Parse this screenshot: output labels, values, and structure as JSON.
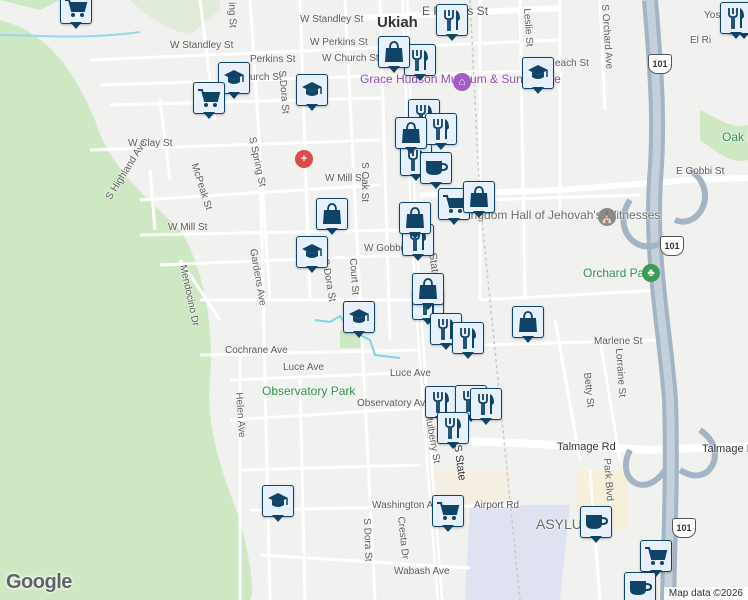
{
  "city": "Ukiah",
  "places": {
    "museum": "Grace Hudson Museum & Sun House",
    "kingdom_hall": "Kingdom Hall of Jehovah's Witnesses",
    "orchard_park": "Orchard Park",
    "observatory_park": "Observatory Park",
    "oak_manor_partial": "Oak M",
    "asylum_partial": "ASYLU"
  },
  "streets": {
    "w_standley": "W Standley St",
    "w_standley2": "W Standley St",
    "w_perkins": "W Perkins St",
    "w_perkins2": "Perkins St",
    "e_perkins": "E Perkins St",
    "w_church": "W Church St",
    "church2": "urch St",
    "w_clay": "W Clay St",
    "w_mill": "W Mill St",
    "w_mill2": "W Mill St",
    "w_gobbi": "W Gobbi St",
    "e_gobbi": "E Gobbi St",
    "s_oak": "S Oak St",
    "s_highland": "S Highland Ave",
    "mcpeak": "McPeak St",
    "s_spring": "S Spring St",
    "s_dora": "S Dora St",
    "s_dora2": "S Dora St",
    "gardens": "Gardens Ave",
    "mendocino": "Mendocino Dr",
    "court": "Court St",
    "cochrane": "Cochrane Ave",
    "luce": "Luce Ave",
    "luce2": "Luce Ave",
    "observatory_ave": "Observatory Ave",
    "helen": "Helen Ave",
    "washington": "Washington Ave",
    "airport": "Airport Rd",
    "cresta": "Cresta Dr",
    "wabash": "Wabash Ave",
    "talmage": "Talmage Rd",
    "talmage2": "Talmage Rd",
    "state": "State",
    "s_state": "S State",
    "mulberry": "Mulberry St",
    "leslie": "Leslie St",
    "s_orchard": "S Orchard Ave",
    "yosemite": "Yosemite",
    "el_rio": "El Ri",
    "beach": "each St",
    "marlene": "Marlene St",
    "betty": "Betty St",
    "lorraine": "Lorraine St",
    "park_blvd": "Park Blvd",
    "hwy101": "101",
    "ing_st": "ing St"
  },
  "attribution": "Map data ©2026",
  "logo": "Google",
  "marker_counts": {
    "school": 7,
    "shopping_cart": 5,
    "restaurant": 14,
    "shopping_bag": 6,
    "cafe": 3
  },
  "colors": {
    "marker_border": "#0f4468",
    "marker_fill": "#e8f1fb",
    "park_green": "#cfe8c4",
    "freeway": "#a3b4c4",
    "hospital": "#dd4b4b",
    "museum_poi": "#a25cc6"
  }
}
